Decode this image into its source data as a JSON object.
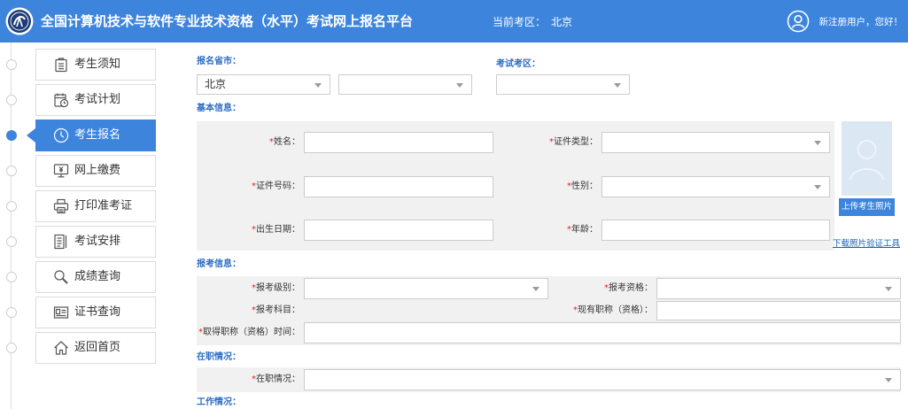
{
  "header": {
    "title": "全国计算机技术与软件专业技术资格（水平）考试网上报名平台",
    "region_label": "当前考区：",
    "region_value": "北京",
    "greeting": "新注册用户，您好！",
    "logo_icon": "exam-logo-icon",
    "user_icon": "user-icon"
  },
  "colors": {
    "header_bg": "#3d85dc",
    "active_nav": "#3d85dc",
    "section_label": "#2b6cc4",
    "required_mark": "#e02020",
    "link": "#1a5fb4"
  },
  "sidebar": {
    "active_index": 2,
    "items": [
      {
        "label": "考生须知",
        "icon": "notice-icon"
      },
      {
        "label": "考试计划",
        "icon": "calendar-clock-icon"
      },
      {
        "label": "考生报名",
        "icon": "clock-icon"
      },
      {
        "label": "网上缴费",
        "icon": "monitor-yen-icon"
      },
      {
        "label": "打印准考证",
        "icon": "printer-icon"
      },
      {
        "label": "考试安排",
        "icon": "document-list-icon"
      },
      {
        "label": "成绩查询",
        "icon": "search-icon"
      },
      {
        "label": "证书查询",
        "icon": "certificate-icon"
      },
      {
        "label": "返回首页",
        "icon": "home-icon"
      }
    ]
  },
  "form": {
    "required_mark": "*",
    "location": {
      "province_label": "报名省市：",
      "province_value": "北京",
      "exam_area_label": "考试考区："
    },
    "basic": {
      "section_label": "基本信息：",
      "name_label": "姓名：",
      "id_type_label": "证件类型：",
      "id_number_label": "证件号码：",
      "gender_label": "性别：",
      "birth_date_label": "出生日期：",
      "age_label": "年龄：",
      "upload_photo_button": "上传考生照片",
      "download_tool_link": "下载照片验证工具"
    },
    "application": {
      "section_label": "报考信息：",
      "level_label": "报考级别：",
      "qualification_label": "报考资格：",
      "subject_label": "报考科目：",
      "current_title_label": "现有职称（资格）：",
      "title_time_label": "取得职称（资格）时间："
    },
    "employment": {
      "section_label": "在职情况：",
      "status_label": "在职情况："
    },
    "work": {
      "section_label": "工作情况："
    }
  }
}
